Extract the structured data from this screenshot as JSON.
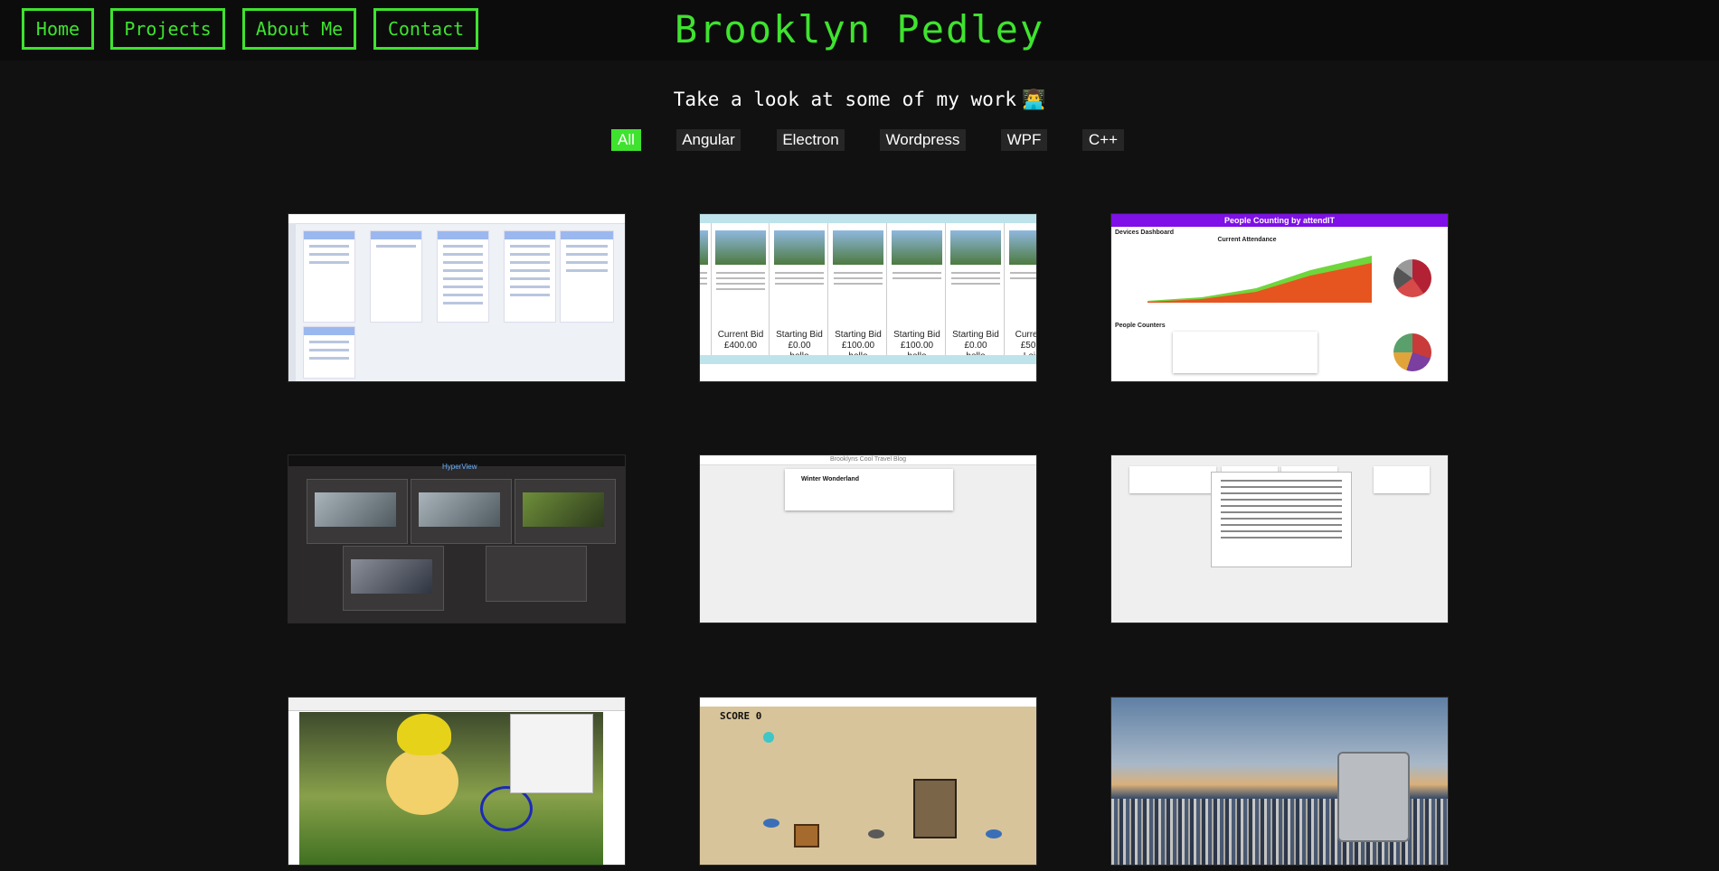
{
  "nav": {
    "home": "Home",
    "projects": "Projects",
    "about": "About Me",
    "contact": "Contact"
  },
  "brand": "Brooklyn Pedley",
  "intro": {
    "text": "Take a look at some of my work",
    "emoji": "👨‍💻"
  },
  "filters": [
    "All",
    "Angular",
    "Electron",
    "Wordpress",
    "WPF",
    "C++"
  ],
  "active_filter": "All",
  "colors": {
    "accent": "#3fe32f",
    "background": "#111111",
    "header": "#0c0c0c",
    "chip": "#262626"
  },
  "projects": {
    "p2": {
      "lots": [
        {
          "bid_label": "Current Bid",
          "amount": "£400.00",
          "bidder": ""
        },
        {
          "bid_label": "Starting Bid",
          "amount": "£0.00",
          "bidder": "hello"
        },
        {
          "bid_label": "Starting Bid",
          "amount": "£100.00",
          "bidder": "hello"
        },
        {
          "bid_label": "Starting Bid",
          "amount": "£100.00",
          "bidder": "hello"
        },
        {
          "bid_label": "Starting Bid",
          "amount": "£0.00",
          "bidder": "hello"
        },
        {
          "bid_label": "Current B",
          "amount": "£50.00",
          "bidder": "Leigh"
        }
      ]
    },
    "p3": {
      "app_title": "People Counting by attendIT",
      "section1": "Devices Dashboard",
      "chart_title": "Current Attendance",
      "section2": "People Counters"
    },
    "p4": {
      "app_name": "HyperView"
    },
    "p5": {
      "blog_title": "Brooklyns Cool Travel Blog",
      "post_title": "Winter Wonderland"
    },
    "p8": {
      "score_label": "SCORE 0"
    }
  }
}
